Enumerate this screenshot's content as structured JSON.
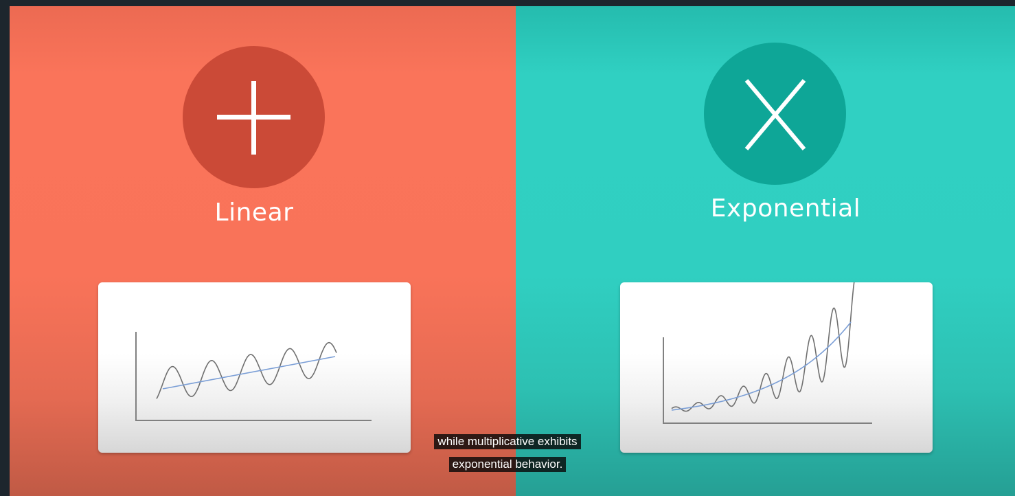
{
  "panels": {
    "left": {
      "label": "Linear",
      "icon": "plus-icon",
      "background": "#fa745a",
      "circle_color": "#cb4a37"
    },
    "right": {
      "label": "Exponential",
      "icon": "x-icon",
      "background": "#30cfc1",
      "circle_color": "#0ea697"
    }
  },
  "captions": {
    "line1": "while multiplicative exhibits",
    "line2": "exponential behavior."
  },
  "colors": {
    "curve": "#6f6f6f",
    "trend": "#7a9ed6",
    "axis": "#808080"
  }
}
